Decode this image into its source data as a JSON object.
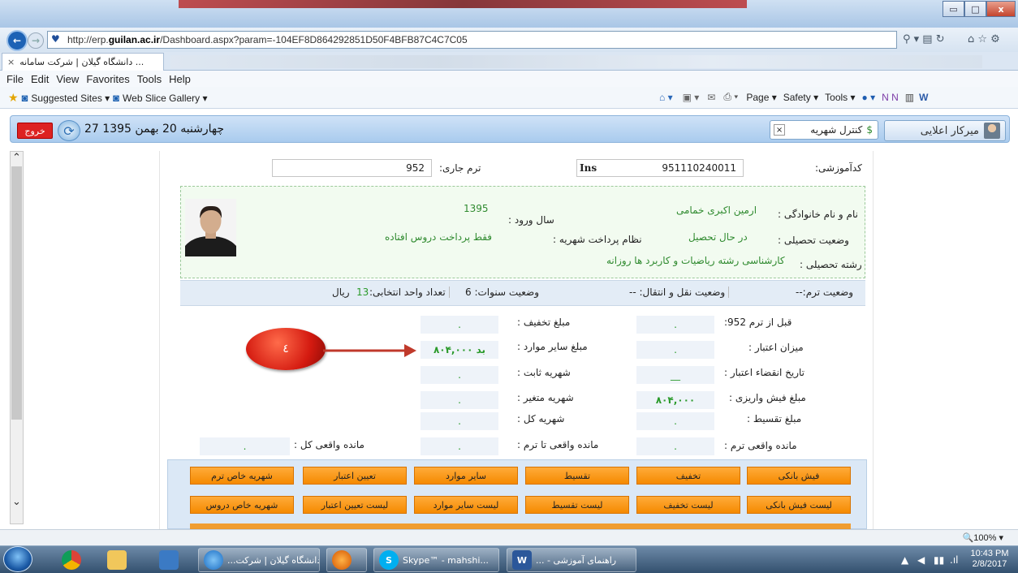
{
  "window": {
    "min": "▭",
    "max": "□",
    "close": "x"
  },
  "browser": {
    "url_prefix": "http://erp.",
    "url_domain": "guilan.ac.ir",
    "url_path": "/Dashboard.aspx?param=-104EF8D864292851D50F4BFB87C4C7C05",
    "tab_title": "... دانشگاه گیلان | شرکت سامانه",
    "tab_close": "×",
    "menu": [
      "File",
      "Edit",
      "View",
      "Favorites",
      "Tools",
      "Help"
    ],
    "favorites": [
      "Suggested Sites ▾",
      "Web Slice Gallery ▾"
    ],
    "cmd": [
      "Page ▾",
      "Safety ▾",
      "Tools ▾"
    ],
    "zoom": "🔍100%  ▾"
  },
  "app": {
    "logout": "خروج",
    "date": "چهارشنبه 20 بهمن 1395 27",
    "tuition_control": "کنترل شهریه",
    "user_name": "میرکار اعلایی",
    "term_label": "ترم جاری:",
    "term_value": "952",
    "ins_label": "Ins",
    "code_label": "کدآموزشی:",
    "code_value": "951110240011",
    "info": {
      "name_label": "نام و نام خانوادگی :",
      "name_value": "ارمین اکبری خمامی",
      "status_label": "وضعیت تحصیلی :",
      "status_value": "در حال تحصیل",
      "major_label": "رشته تحصیلی :",
      "major_value": "کارشناسی رشته ریاضیات و کاربرد ها روزانه",
      "entry_label": "سال ورود :",
      "entry_value": "1395",
      "pay_label": "نظام پرداخت شهریه :",
      "pay_value": "فقط پرداخت دروس افتاده"
    },
    "statusbar": {
      "term_status": "وضعیت ترم:--",
      "transfer_status": "وضعیت نقل و انتقال: --",
      "years_status": "وضعیت سنوات: 6",
      "units_label": "تعداد واحد انتخابی:",
      "units_value": "13",
      "currency": "ریال"
    },
    "finance_right": [
      {
        "label": "قبل از ترم 952:",
        "value": "."
      },
      {
        "label": "میزان اعتبار :",
        "value": "."
      },
      {
        "label": "تاریخ انقضاء اعتبار :",
        "value": "__"
      },
      {
        "label": "مبلغ فیش واریزی :",
        "value": "۸۰۴,۰۰۰"
      },
      {
        "label": "مبلغ تقسیط :",
        "value": "."
      }
    ],
    "finance_mid": [
      {
        "label": "مبلغ تخفیف :",
        "value": "."
      },
      {
        "label": "مبلغ سایر موارد :",
        "value": "۸۰۴,۰۰۰ بد"
      },
      {
        "label": "شهریه ثابت :",
        "value": "."
      },
      {
        "label": "شهریه متغیر :",
        "value": "."
      },
      {
        "label": "شهریه کل :",
        "value": "."
      }
    ],
    "remaining": [
      {
        "label": "مانده واقعی ترم :",
        "value": "."
      },
      {
        "label": "مانده واقعی تا ترم :",
        "value": "."
      },
      {
        "label": "مانده واقعی کل :",
        "value": "."
      }
    ],
    "callout": "٤",
    "buttons_row1": [
      "فیش بانکی",
      "تخفیف",
      "تقسیط",
      "سایر موارد",
      "تعیین اعتبار",
      "شهریه خاص ترم"
    ],
    "buttons_row2": [
      "لیست فیش بانکی",
      "لیست تخفیف",
      "لیست تقسیط",
      "لیست سایر موارد",
      "لیست تعیین اعتبار",
      "شهریه خاص دروس"
    ]
  },
  "taskbar": {
    "ie_item": "...دانشگاه گیلان | شرکت",
    "skype_item": "Skype™ - mahshi...",
    "word_item": "... - راهنمای آموزشی",
    "time": "10:43 PM",
    "date": "2/8/2017"
  },
  "colors": {
    "accent": "#f58a00",
    "header": "#a9cbee",
    "info_bg": "#f2fbf0",
    "value_green": "#2a9a2a",
    "logout": "#dd2222"
  }
}
